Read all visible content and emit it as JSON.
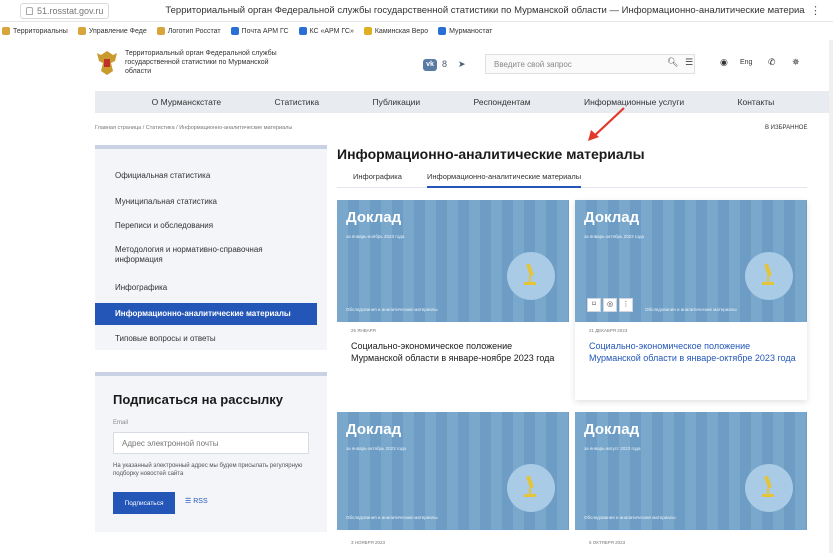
{
  "browser": {
    "url": "51.rosstat.gov.ru",
    "title": "Территориальный орган Федеральной службы государственной статистики по Мурманской области — Информационно-аналитические материалы",
    "menu": "⋮"
  },
  "bookmarks": [
    {
      "label": "Территориальны",
      "color": "#d7a53a"
    },
    {
      "label": "Управление Феде",
      "color": "#d7a53a"
    },
    {
      "label": "Логотип Росстат",
      "color": "#d7a53a"
    },
    {
      "label": "Почта АРМ ГС",
      "color": "#2a6fd6"
    },
    {
      "label": "КС «АРМ ГС»",
      "color": "#2a6fd6"
    },
    {
      "label": "Каминская Веро",
      "color": "#e0b020"
    },
    {
      "label": "Мурманостат",
      "color": "#2a6fd6"
    }
  ],
  "header": {
    "org_name": "Территориальный орган Федеральной службы государственной статистики по Мурманской области",
    "vk": "vk",
    "search_placeholder": "Введите свой запрос",
    "lang": "Eng"
  },
  "nav": [
    "О Мурманскстате",
    "Статистика",
    "Публикации",
    "Респондентам",
    "Информационные услуги",
    "Контакты"
  ],
  "breadcrumb": "Главная страница / Статистика / Информационно-аналитические материалы",
  "favorites": "В ИЗБРАННОЕ",
  "sidebar": {
    "items": [
      {
        "label": "Официальная статистика"
      },
      {
        "label": "Муниципальная статистика"
      },
      {
        "label": "Переписи и обследования"
      },
      {
        "label": "Методология и нормативно-справочная информация"
      },
      {
        "label": "Инфографика"
      },
      {
        "label": "Информационно-аналитические материалы"
      },
      {
        "label": "Типовые вопросы и ответы"
      }
    ],
    "active_index": 5
  },
  "subscribe": {
    "title": "Подписаться на рассылку",
    "email_label": "Email",
    "email_placeholder": "Адрес электронной почты",
    "note": "На указанный электронный адрес мы будем присылать регулярную подборку новостей сайта",
    "button": "Подписаться",
    "rss": "RSS"
  },
  "main": {
    "title": "Информационно-аналитические материалы",
    "tabs": [
      "Инфографика",
      "Информационно-аналитические материалы"
    ],
    "active_tab": 1,
    "cards": [
      {
        "kicker": "Доклад",
        "period": "за январь-ноябрь 2023 года",
        "category": "Обследования и аналитические материалы",
        "date": "25 ЯНВАРЯ",
        "text": "Социально-экономическое положение Мурманской области в январе-ноябре 2023 года"
      },
      {
        "kicker": "Доклад",
        "period": "за январь-октябрь 2023 года",
        "category": "Обследования и аналитические материалы",
        "date": "21 ДЕКАБРЯ 2023",
        "text": "Социально-экономическое положение Мурманской области в январе-октябре 2023 года"
      },
      {
        "kicker": "Доклад",
        "period": "за январь-октябрь 2023 года",
        "category": "Обследования и аналитические материалы",
        "date": "3 НОЯБРЯ 2023"
      },
      {
        "kicker": "Доклад",
        "period": "за январь-август 2023 года",
        "category": "Обследования и аналитические материалы",
        "date": "5 ОКТЯБРЯ 2023"
      }
    ]
  },
  "colors": {
    "accent": "#2456b8",
    "card_bg": "#7aa8cc",
    "nav_bg": "#e8ebf0",
    "arrow": "#e23a2a"
  }
}
